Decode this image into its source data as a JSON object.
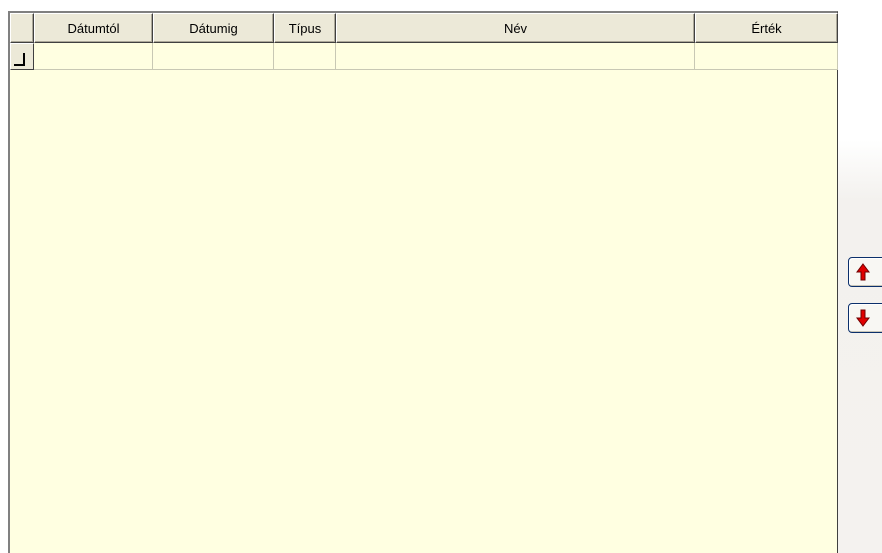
{
  "grid": {
    "columns": [
      {
        "label": "Dátumtól"
      },
      {
        "label": "Dátumig"
      },
      {
        "label": "Típus"
      },
      {
        "label": "Név"
      },
      {
        "label": "Érték"
      }
    ],
    "rows": [
      [
        "",
        "",
        "",
        "",
        ""
      ]
    ],
    "background_color": "#ffffe1",
    "header_color": "#ece9d8"
  },
  "side_buttons": [
    {
      "icon": "arrow-up-icon",
      "color": "#e00000"
    },
    {
      "icon": "arrow-down-icon",
      "color": "#e00000"
    }
  ]
}
